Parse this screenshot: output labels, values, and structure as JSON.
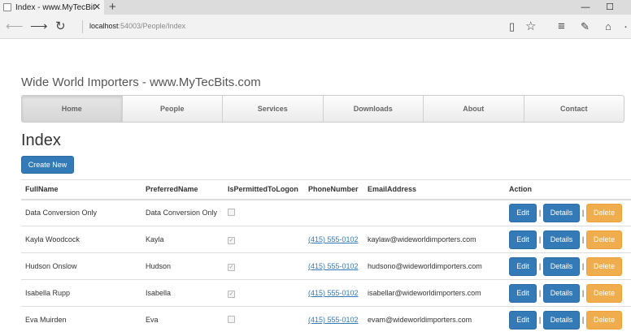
{
  "browser": {
    "tab_title": "Index - www.MyTecBits.c",
    "tab_close": "✕",
    "new_tab": "+",
    "address_host": "localhost",
    "address_path": ":54003/People/Index",
    "win_minimize": "—",
    "win_maximize": "☐"
  },
  "site": {
    "title": "Wide World Importers - www.MyTecBits.com",
    "menu": [
      {
        "label": "Home"
      },
      {
        "label": "People"
      },
      {
        "label": "Services"
      },
      {
        "label": "Downloads"
      },
      {
        "label": "About"
      },
      {
        "label": "Contact"
      }
    ]
  },
  "page": {
    "heading": "Index",
    "create_label": "Create New"
  },
  "table": {
    "headers": [
      "FullName",
      "PreferredName",
      "IsPermittedToLogon",
      "PhoneNumber",
      "EmailAddress",
      "Action"
    ],
    "rows": [
      {
        "full_name": "Data Conversion Only",
        "preferred": "Data Conversion Only",
        "permitted": false,
        "phone": "",
        "email": ""
      },
      {
        "full_name": "Kayla Woodcock",
        "preferred": "Kayla",
        "permitted": true,
        "phone": "(415) 555-0102",
        "email": "kaylaw@wideworldimporters.com"
      },
      {
        "full_name": "Hudson Onslow",
        "preferred": "Hudson",
        "permitted": true,
        "phone": "(415) 555-0102",
        "email": "hudsono@wideworldimporters.com"
      },
      {
        "full_name": "Isabella Rupp",
        "preferred": "Isabella",
        "permitted": true,
        "phone": "(415) 555-0102",
        "email": "isabellar@wideworldimporters.com"
      },
      {
        "full_name": "Eva Muirden",
        "preferred": "Eva",
        "permitted": false,
        "phone": "(415) 555-0102",
        "email": "evam@wideworldimporters.com"
      }
    ],
    "action_labels": {
      "edit": "Edit",
      "details": "Details",
      "delete": "Delete",
      "separator": "|"
    },
    "checked_glyph": "✓"
  }
}
